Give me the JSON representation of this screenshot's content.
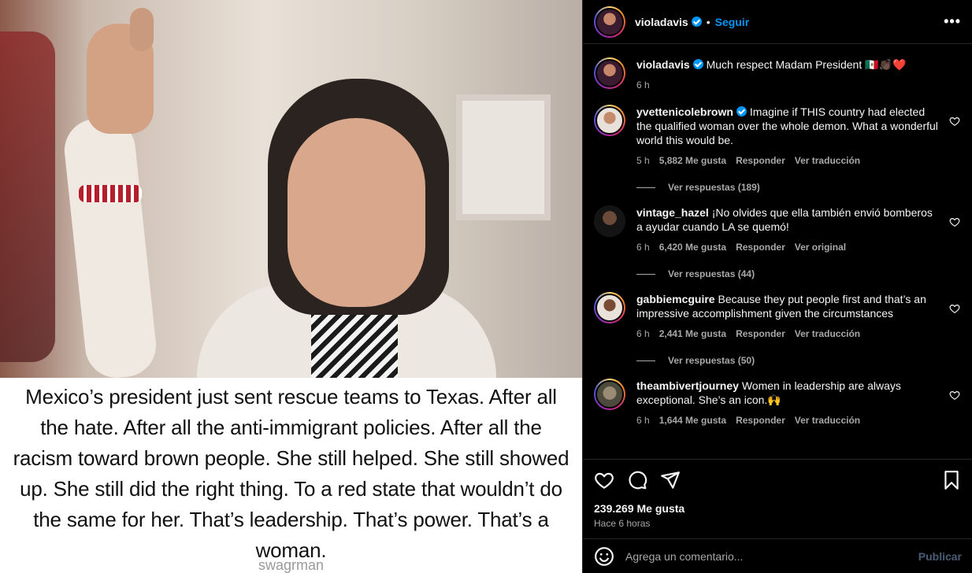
{
  "post": {
    "author": "violadavis",
    "follow_label": "Seguir",
    "dot": "•",
    "more_label": "•••",
    "media_caption": "Mexico’s president just sent rescue teams to Texas. After all the hate. After all the anti-immigrant policies. After all the racism toward brown people. She still helped. She still showed up. She still did the right thing. To a red state that wouldn’t do the same for her. That’s leadership. That’s power. That’s a woman.",
    "media_watermark": "swagrman",
    "caption": {
      "username": "violadavis",
      "text": "Much respect Madam President 🇲🇽👏🏿❤️",
      "time": "6 h"
    },
    "likes": "239.269 Me gusta",
    "time_ago": "Hace 6 horas"
  },
  "comments": [
    {
      "username": "yvettenicolebrown",
      "verified": true,
      "text": "Imagine if THIS country had elected the qualified woman over the whole demon. What a wonderful world this would be.",
      "time": "5 h",
      "likes": "5,882 Me gusta",
      "reply_label": "Responder",
      "translate_label": "Ver traducción",
      "replies_label": "Ver respuestas (189)"
    },
    {
      "username": "vintage_hazel",
      "verified": false,
      "text": "¡No olvides que ella también envió bomberos a ayudar cuando LA se quemó!",
      "time": "6 h",
      "likes": "6,420 Me gusta",
      "reply_label": "Responder",
      "translate_label": "Ver original",
      "replies_label": "Ver respuestas (44)"
    },
    {
      "username": "gabbiemcguire",
      "verified": false,
      "text": "Because they put people first and that’s an impressive accomplishment given the circumstances",
      "time": "6 h",
      "likes": "2,441 Me gusta",
      "reply_label": "Responder",
      "translate_label": "Ver traducción",
      "replies_label": "Ver respuestas (50)"
    },
    {
      "username": "theambivertjourney",
      "verified": false,
      "text": "Women in leadership are always exceptional. She’s an icon.🙌",
      "time": "6 h",
      "likes": "1,644 Me gusta",
      "reply_label": "Responder",
      "translate_label": "Ver traducción",
      "replies_label": ""
    }
  ],
  "comment_box": {
    "placeholder": "Agrega un comentario...",
    "publish_label": "Publicar"
  },
  "colors": {
    "background": "#000000",
    "link": "#0095f6",
    "muted": "#a8a8a8",
    "publish_disabled": "#4a5d75"
  },
  "icons": [
    "heart-icon",
    "comment-icon",
    "share-icon",
    "bookmark-icon",
    "emoji-icon",
    "verified-icon",
    "more-icon"
  ]
}
